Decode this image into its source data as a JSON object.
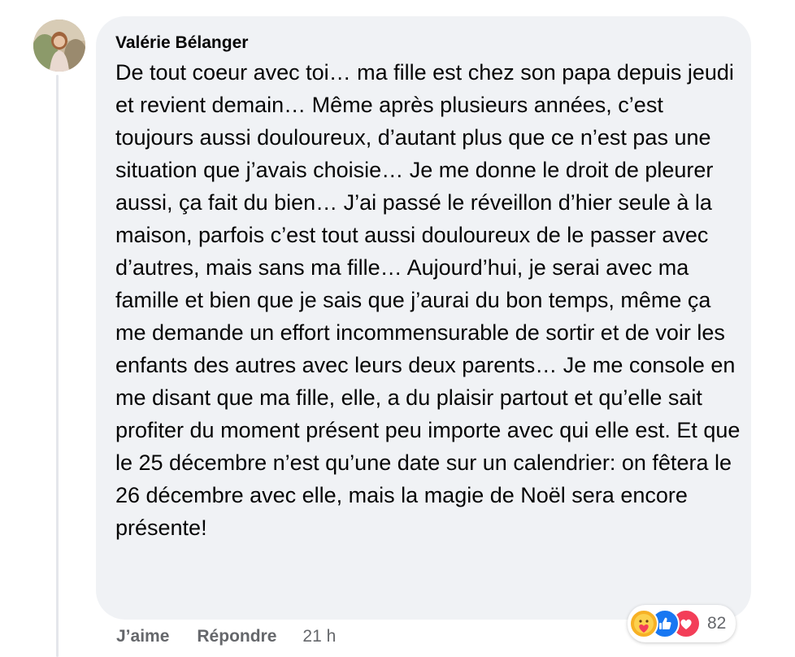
{
  "comment": {
    "author": "Valérie Bélanger",
    "text": "De tout coeur avec toi… ma fille est chez son papa depuis jeudi et revient demain… Même après plusieurs années, c’est toujours aussi douloureux, d’autant plus que ce n’est pas une situation que j’avais choisie… Je me donne le droit de pleurer aussi, ça fait du bien… J’ai passé le réveillon d’hier seule à la maison, parfois c’est tout aussi douloureux de le passer avec d’autres, mais sans ma fille… Aujourd’hui, je serai avec ma famille et bien que je sais que j’aurai du bon temps, même ça me demande un effort incommensurable de sortir et de voir les enfants des autres avec leurs deux parents… Je me console en me disant que ma fille, elle, a du plaisir partout et qu’elle sait profiter du moment présent peu importe avec qui elle est. Et que le 25 décembre n’est qu’une date sur un calendrier: on fêtera le 26 décembre avec elle, mais la magie de Noël sera encore présente!"
  },
  "reactions": {
    "icons": [
      "care-icon",
      "like-icon",
      "love-icon"
    ],
    "count": "82"
  },
  "actions": {
    "like_label": "J’aime",
    "reply_label": "Répondre",
    "timestamp": "21 h"
  },
  "colors": {
    "bubble_bg": "#f0f2f5",
    "text": "#050505",
    "secondary_text": "#65676b",
    "like_blue": "#1877f2",
    "love_red": "#f33e58",
    "care_yellow": "#f7b125"
  }
}
